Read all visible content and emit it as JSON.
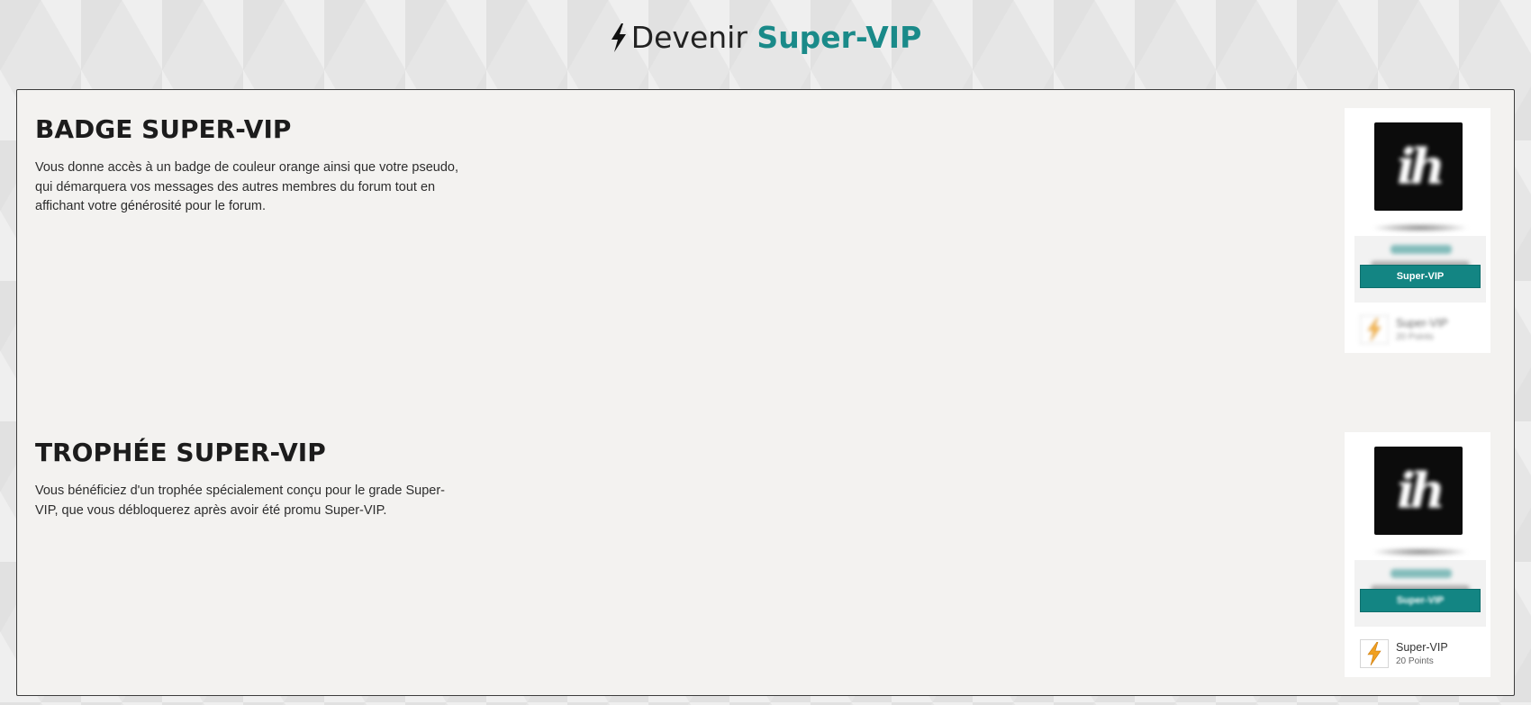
{
  "header": {
    "prefix": "Devenir",
    "accent": "Super-VIP",
    "icon": "bolt-icon"
  },
  "sections": [
    {
      "title": "BADGE SUPER-VIP",
      "description": "Vous donne accès à un badge de couleur orange ainsi que votre pseudo, qui démarquera vos messages des autres membres du forum tout en affichant votre générosité pour le forum.",
      "preview": {
        "badge_label": "Super-VIP",
        "trophy_name": "Super-VIP",
        "trophy_points": "20 Points"
      }
    },
    {
      "title": "TROPHÉE SUPER-VIP",
      "description": "Vous bénéficiez d'un trophée spécialement conçu pour le grade Super-VIP, que vous débloquerez après avoir été promu Super-VIP.",
      "preview": {
        "badge_label": "Super-VIP",
        "trophy_name": "Super-VIP",
        "trophy_points": "20 Points"
      }
    }
  ],
  "colors": {
    "accent": "#1a8a89",
    "badge": "#138583",
    "trophy": "#f0a020"
  },
  "avatar_text": "ih"
}
